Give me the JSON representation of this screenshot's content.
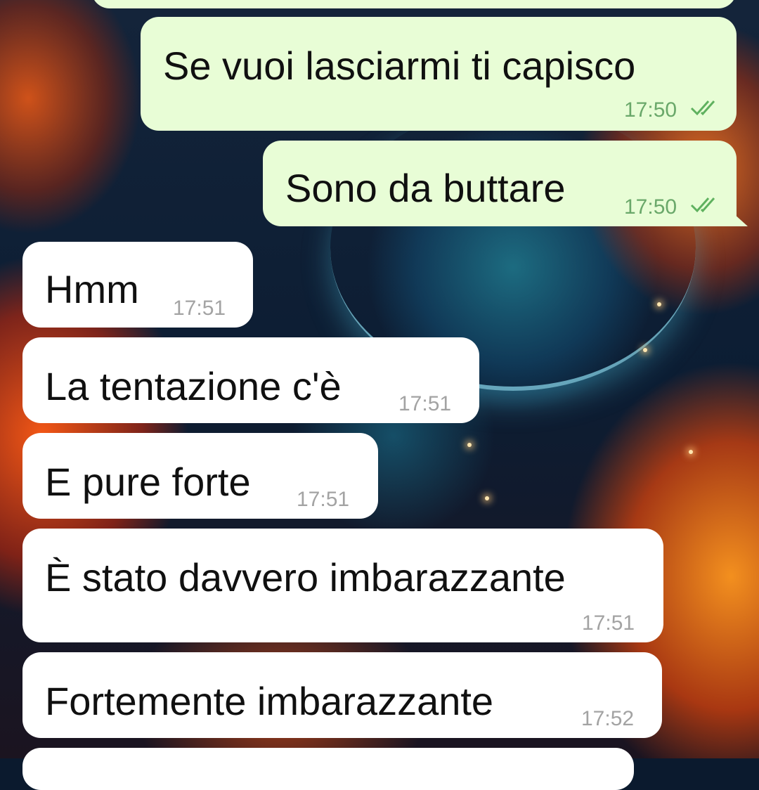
{
  "chat": {
    "messages": [
      {
        "direction": "outgoing",
        "text": "Se vuoi lasciarmi ti capisco",
        "time": "17:50",
        "status_icon": "double-check-icon"
      },
      {
        "direction": "outgoing",
        "text": "Sono da buttare",
        "time": "17:50",
        "status_icon": "double-check-icon"
      },
      {
        "direction": "incoming",
        "text": "Hmm",
        "time": "17:51"
      },
      {
        "direction": "incoming",
        "text": "La tentazione c'è",
        "time": "17:51"
      },
      {
        "direction": "incoming",
        "text": "E pure forte",
        "time": "17:51"
      },
      {
        "direction": "incoming",
        "text": "È stato davvero imbarazzante",
        "time": "17:51"
      },
      {
        "direction": "incoming",
        "text": "Fortemente imbarazzante",
        "time": "17:52"
      }
    ]
  },
  "colors": {
    "outgoing_bubble": "#e8fdd6",
    "incoming_bubble": "#ffffff",
    "read_tick": "#5fb15f"
  }
}
